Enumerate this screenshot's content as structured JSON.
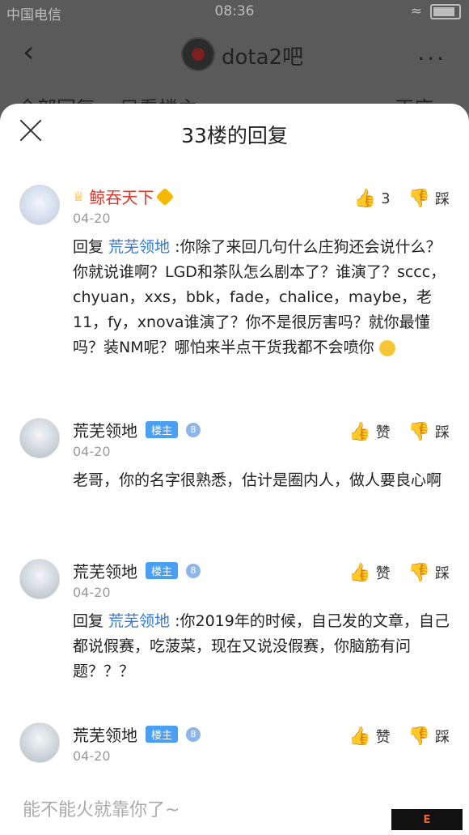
{
  "statusbar": {
    "carrier": "中国电信",
    "time": "08:36"
  },
  "topbar": {
    "back_icon": "chevron-left-icon",
    "forum_title": "dota2吧",
    "more_label": "..."
  },
  "tabs_bg": {
    "tab1": "全部回复",
    "tab2": "只看楼主",
    "sort": "正序"
  },
  "sheet": {
    "title": "33楼的回复",
    "close_icon": "close-icon"
  },
  "replies": [
    {
      "username": "鲸吞天下",
      "date": "04-20",
      "like_count": "3",
      "dislike_label": "踩",
      "content_prefix": "回复 ",
      "mention": "荒芜领地",
      "content": " :你除了来回几句什么庄狗还会说什么？你就说谁啊？LGD和茶队怎么剧本了？谁演了？sccc，chyuan，xxs，bbk，fade，chalice，maybe，老11，fy，xnova谁演了？你不是很厉害吗？就你最懂吗？装NM呢？哪怕来半点干货我都不会喷你"
    },
    {
      "username": "荒芜领地",
      "badge": "楼主",
      "level": "8",
      "date": "04-20",
      "like_label": "赞",
      "dislike_label": "踩",
      "content": "老哥，你的名字很熟悉，估计是圈内人，做人要良心啊"
    },
    {
      "username": "荒芜领地",
      "badge": "楼主",
      "level": "8",
      "date": "04-20",
      "like_label": "赞",
      "dislike_label": "踩",
      "content_prefix": "回复 ",
      "mention": "荒芜领地",
      "content": " :你2019年的时候，自己发的文章，自己都说假赛，吃菠菜，现在又说没假赛，你脑筋有问题？？？"
    },
    {
      "username": "荒芜领地",
      "badge": "楼主",
      "level": "8",
      "date": "04-20",
      "like_label": "赞",
      "dislike_label": "踩"
    }
  ],
  "input": {
    "placeholder": "能不能火就靠你了~"
  },
  "colors": {
    "mention": "#2f7ad8",
    "vip_name": "#e0352b",
    "badge": "#4a9ff2"
  }
}
